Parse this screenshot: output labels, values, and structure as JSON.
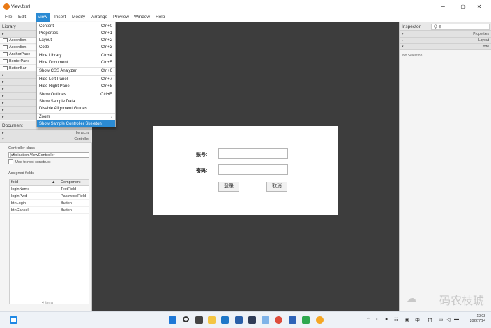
{
  "window": {
    "title": "View.fxml",
    "min": "–",
    "max": "▢",
    "close": "✕"
  },
  "menu": [
    "File",
    "Edit",
    "View",
    "Insert",
    "Modify",
    "Arrange",
    "Preview",
    "Window",
    "Help"
  ],
  "library": {
    "title": "Library",
    "items": [
      "Accordion",
      "Accordion",
      "AnchorPane",
      "BorderPane",
      "ButtonBar"
    ]
  },
  "document": {
    "title": "Document",
    "hierarchy": "Hierarchy",
    "controller": "Controller",
    "controller_class_label": "Controller class",
    "controller_class": "application.ViewController",
    "use_root": "Use fx:root construct",
    "assigned_label": "Assigned fields",
    "columns": [
      "fx:id",
      "Component"
    ],
    "rows": [
      [
        "loginName",
        "TextField"
      ],
      [
        "loginPwd",
        "PasswordField"
      ],
      [
        "btnLogin",
        "Button"
      ],
      [
        "btnCancel",
        "Button"
      ]
    ],
    "items": "4 items"
  },
  "view_menu": [
    {
      "label": "Content",
      "key": "Ctrl+0"
    },
    {
      "label": "Properties",
      "key": "Ctrl+1"
    },
    {
      "label": "Layout",
      "key": "Ctrl+2"
    },
    {
      "label": "Code",
      "key": "Ctrl+3"
    },
    {
      "label": "Hide Library",
      "key": "Ctrl+4"
    },
    {
      "label": "Hide Document",
      "key": "Ctrl+5"
    },
    {
      "label": "Show CSS Analyzer",
      "key": "Ctrl+6"
    },
    {
      "label": "Hide Left Panel",
      "key": "Ctrl+7"
    },
    {
      "label": "Hide Right Panel",
      "key": "Ctrl+8"
    },
    {
      "label": "Show Outlines",
      "key": "Ctrl+E"
    },
    {
      "label": "Show Sample Data",
      "key": ""
    },
    {
      "label": "Disable Alignment Guides",
      "key": ""
    },
    {
      "label": "Zoom",
      "key": "›"
    },
    {
      "label": "Show Sample Controller Skeleton",
      "key": ""
    }
  ],
  "form": {
    "account_label": "账号:",
    "password_label": "密码:",
    "login": "登录",
    "cancel": "取消"
  },
  "inspector": {
    "title": "Inspector",
    "search_icon": "Q ⊕",
    "sections": [
      "Properties",
      "Layout",
      "Code"
    ],
    "status": "No Selection"
  },
  "watermark": "码农枝琥",
  "clock": {
    "time": "13:02",
    "date": "2022/7/24"
  }
}
